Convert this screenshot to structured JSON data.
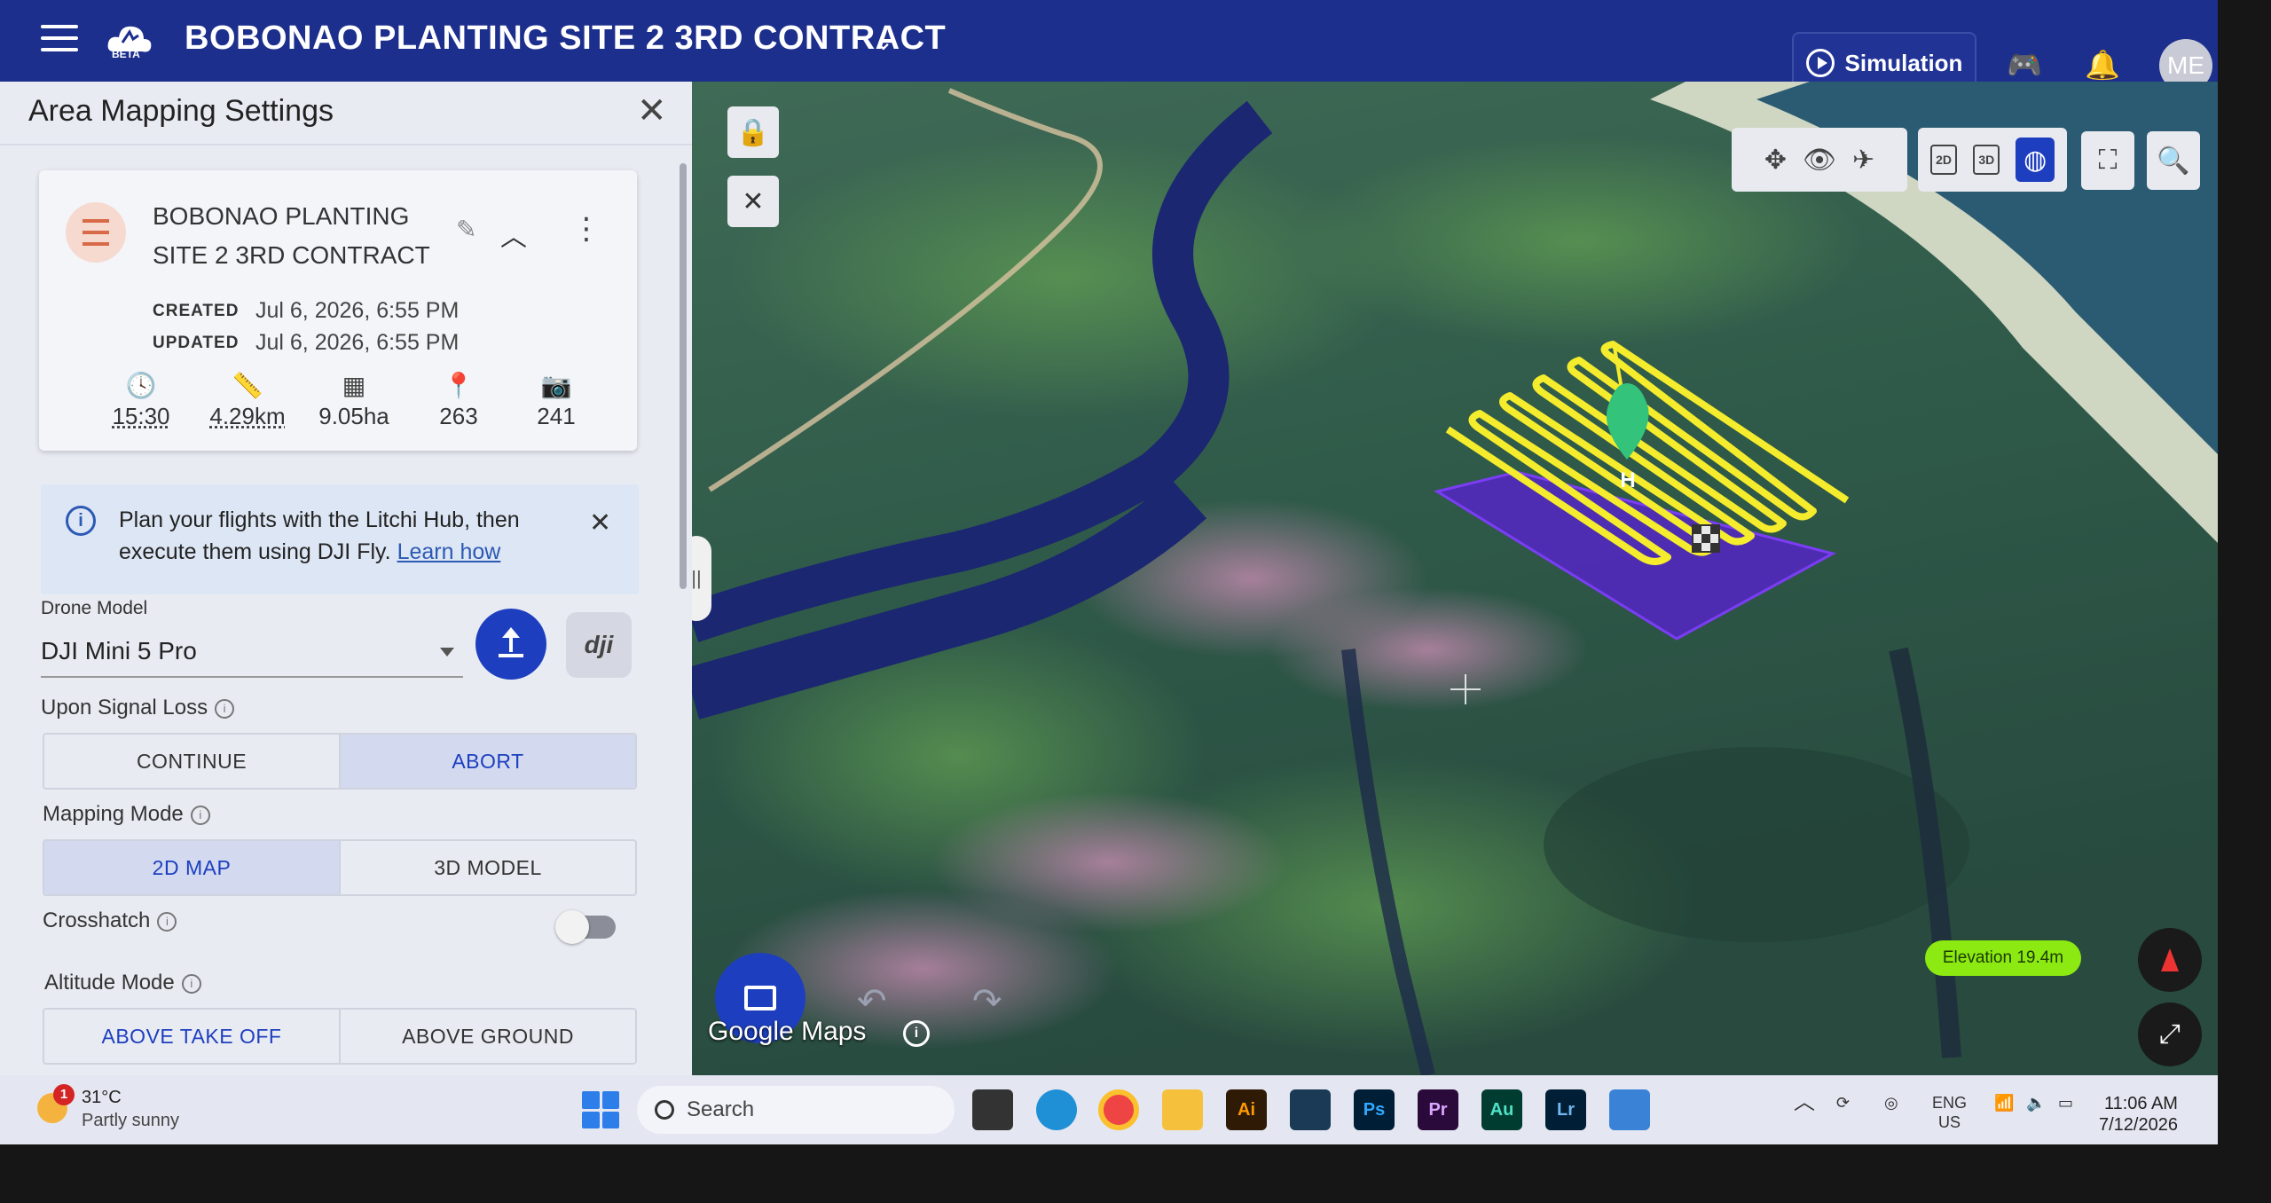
{
  "app": {
    "logo_badge": "BETA",
    "project_title": "BOBONAO PLANTING SITE 2 3RD CONTRACT",
    "simulation_label": "Simulation",
    "avatar_initials": "ME",
    "brand_color": "#1d2f8c"
  },
  "panel": {
    "title": "Area Mapping Settings",
    "mission": {
      "name_line1": "BOBONAO PLANTING",
      "name_line2": "SITE 2 3RD CONTRACT",
      "created_label": "CREATED",
      "created_value": "Jul 6, 2026, 6:55 PM",
      "updated_label": "UPDATED",
      "updated_value": "Jul 6, 2026, 6:55 PM",
      "stats": {
        "duration": "15:30",
        "distance": "4.29km",
        "area": "9.05ha",
        "waypoints": "263",
        "photos": "241"
      }
    },
    "banner": {
      "text": "Plan your flights with the Litchi Hub, then execute them using DJI Fly.",
      "link": "Learn how"
    },
    "drone_model": {
      "label": "Drone Model",
      "value": "DJI Mini 5 Pro",
      "dji_label": "dji"
    },
    "signal_loss": {
      "label": "Upon Signal Loss",
      "options": [
        "CONTINUE",
        "ABORT"
      ],
      "selected": "ABORT"
    },
    "mapping_mode": {
      "label": "Mapping Mode",
      "options": [
        "2D MAP",
        "3D MODEL"
      ],
      "selected": "2D MAP"
    },
    "crosshatch": {
      "label": "Crosshatch",
      "enabled": false
    },
    "altitude_mode": {
      "label": "Altitude Mode",
      "options": [
        "ABOVE TAKE OFF",
        "ABOVE GROUND"
      ],
      "selected": "ABOVE TAKE OFF"
    }
  },
  "map": {
    "home_marker": "H",
    "attribution": "Google Maps",
    "view_2d": "2D",
    "view_3d": "3D",
    "elevation": "Elevation 19.4m",
    "path_color": "#f4ec2c",
    "area_color": "#5a1fd6"
  },
  "taskbar": {
    "weather_temp": "31°C",
    "weather_desc": "Partly sunny",
    "weather_badge": "1",
    "search_placeholder": "Search",
    "apps": [
      "Ai",
      "Ps",
      "Pr",
      "Au",
      "Lr"
    ],
    "language_top": "ENG",
    "language_bottom": "US",
    "time": "11:06 AM",
    "date": "7/12/2026"
  }
}
